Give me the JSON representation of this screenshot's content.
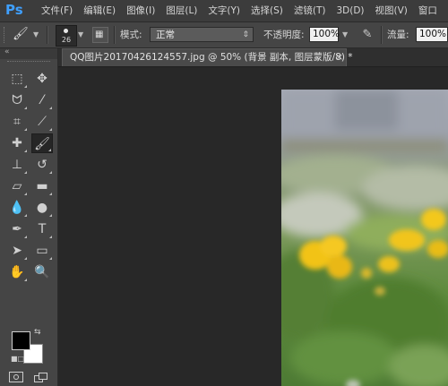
{
  "app": {
    "logo": "Ps",
    "menus": [
      "文件(F)",
      "编辑(E)",
      "图像(I)",
      "图层(L)",
      "文字(Y)",
      "选择(S)",
      "滤镜(T)",
      "3D(D)",
      "视图(V)",
      "窗口"
    ]
  },
  "options": {
    "brush_size": "26",
    "mode_label": "模式:",
    "mode_value": "正常",
    "opacity_label": "不透明度:",
    "opacity_value": "100%",
    "flow_label": "流量:",
    "flow_value": "100%"
  },
  "document": {
    "tab_title": "QQ图片20170426124557.jpg @ 50% (背景 副本, 图层蒙版/8) *",
    "close_glyph": "×"
  },
  "colors": {
    "foreground": "#000000",
    "background": "#ffffff",
    "accent": "#3fa0ff"
  },
  "tools": [
    "rectangular-marquee-icon",
    "move-icon",
    "lasso-icon",
    "quick-selection-icon",
    "crop-icon",
    "eyedropper-icon",
    "spot-healing-brush-icon",
    "brush-icon",
    "clone-stamp-icon",
    "history-brush-icon",
    "eraser-icon",
    "gradient-icon",
    "blur-icon",
    "dodge-icon",
    "pen-icon",
    "type-icon",
    "path-selection-icon",
    "rectangle-icon",
    "hand-icon",
    "zoom-icon"
  ]
}
